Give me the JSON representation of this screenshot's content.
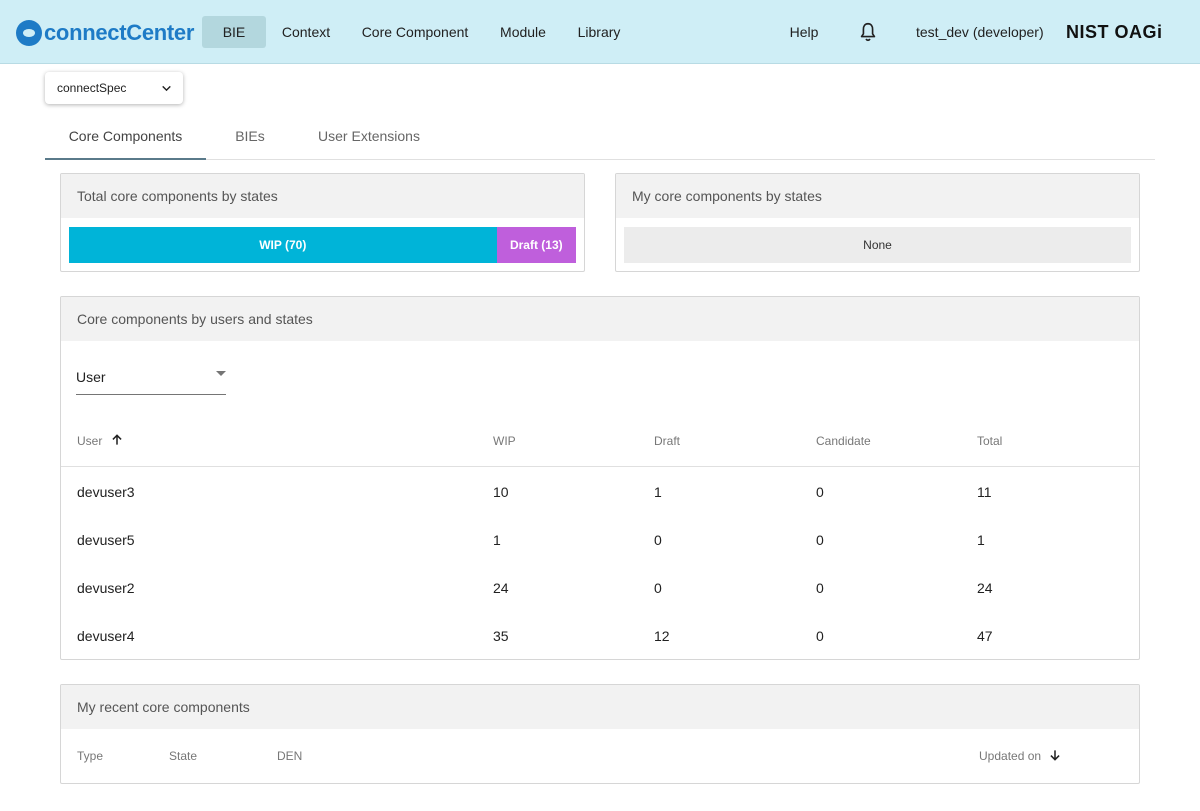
{
  "header": {
    "logo_text": "connectCenter",
    "nav": [
      "BIE",
      "Context",
      "Core Component",
      "Module",
      "Library"
    ],
    "help_label": "Help",
    "user_label": "test_dev (developer)",
    "brand_label": "NIST OAGi"
  },
  "release_select": {
    "value": "connectSpec"
  },
  "tabs": [
    "Core Components",
    "BIEs",
    "User Extensions"
  ],
  "total_card": {
    "title": "Total core components by states",
    "segments": [
      {
        "label": "WIP (70)",
        "state": "WIP",
        "count": 70,
        "color": "#00b4d8"
      },
      {
        "label": "Draft (13)",
        "state": "Draft",
        "count": 13,
        "color": "#bf5fdc"
      }
    ]
  },
  "my_card": {
    "title": "My core components by states",
    "none_label": "None"
  },
  "users_card": {
    "title": "Core components by users and states",
    "user_select_label": "User",
    "columns": [
      "User",
      "WIP",
      "Draft",
      "Candidate",
      "Total"
    ],
    "rows": [
      [
        "devuser3",
        "10",
        "1",
        "0",
        "11"
      ],
      [
        "devuser5",
        "1",
        "0",
        "0",
        "1"
      ],
      [
        "devuser2",
        "24",
        "0",
        "0",
        "24"
      ],
      [
        "devuser4",
        "35",
        "12",
        "0",
        "47"
      ]
    ]
  },
  "recent_card": {
    "title": "My recent core components",
    "columns": [
      "Type",
      "State",
      "DEN",
      "Updated on"
    ]
  },
  "icons": {
    "bell": "bell-icon",
    "chevron": "chevron-down-icon",
    "sort_up": "arrow-up-icon",
    "sort_down": "arrow-down-icon"
  }
}
